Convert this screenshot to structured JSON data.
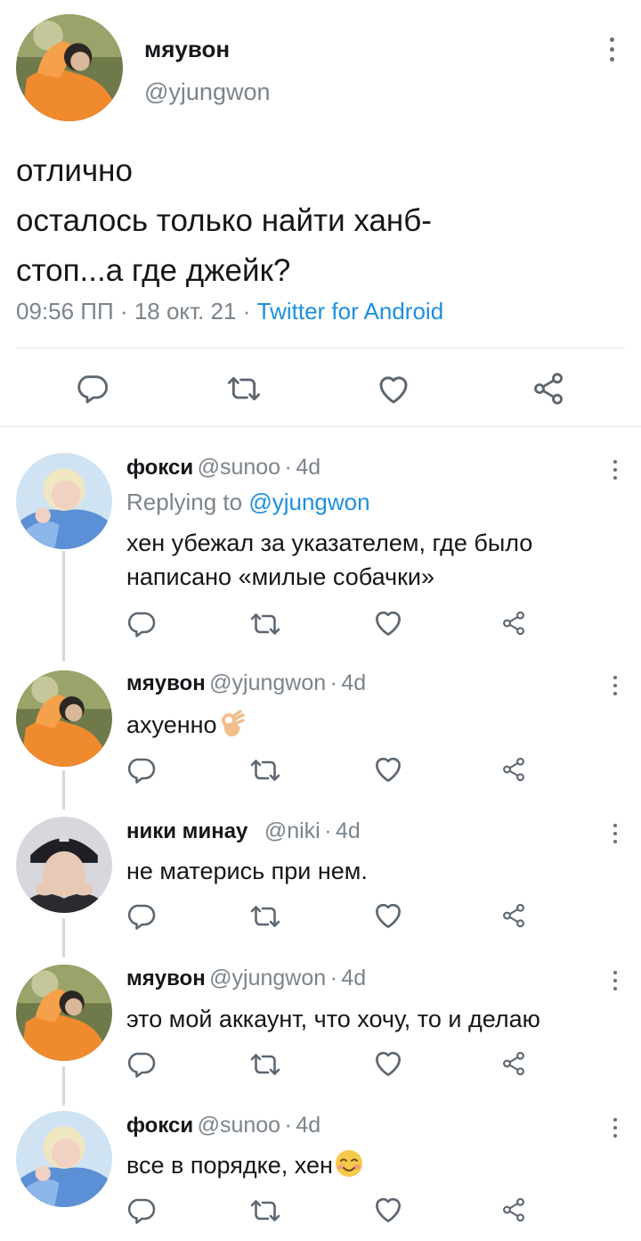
{
  "main_tweet": {
    "display_name": "мяувон",
    "handle": "@yjungwon",
    "text_lines": [
      "отлично",
      "осталось только найти ханб-",
      "стоп...а где джейк?"
    ],
    "time": "09:56 ПП",
    "date": "18 окт. 21",
    "source": "Twitter for Android"
  },
  "replies": [
    {
      "display_name": "фокси",
      "handle": "@sunoo",
      "age": "4d",
      "replying_to_prefix": "Replying to",
      "replying_to_handle": "@yjungwon",
      "text_lines": [
        "хен убежал за указателем, где было",
        "написано «милые собачки»"
      ]
    },
    {
      "display_name": "мяувон",
      "handle": "@yjungwon",
      "age": "4d",
      "text_lines": [
        "ахуенно"
      ],
      "emoji": "ok-hand"
    },
    {
      "display_name": "ники минау",
      "handle": "@niki",
      "age": "4d",
      "text_lines": [
        "не матерись при нем."
      ]
    },
    {
      "display_name": "мяувон",
      "handle": "@yjungwon",
      "age": "4d",
      "text_lines": [
        "это мой аккаунт, что хочу, то и делаю"
      ]
    },
    {
      "display_name": "фокси",
      "handle": "@sunoo",
      "age": "4d",
      "text_lines": [
        "все в порядке, хен"
      ],
      "emoji": "smiling-blush"
    }
  ],
  "separator": "·",
  "icons": [
    "reply-icon",
    "retweet-icon",
    "like-icon",
    "share-icon",
    "more-options-icon"
  ],
  "colors": {
    "link": "#1d8fe0",
    "muted": "#7b848c",
    "text": "#14171a",
    "divider": "#e1e8ed",
    "thread_line": "#cfd9de"
  }
}
